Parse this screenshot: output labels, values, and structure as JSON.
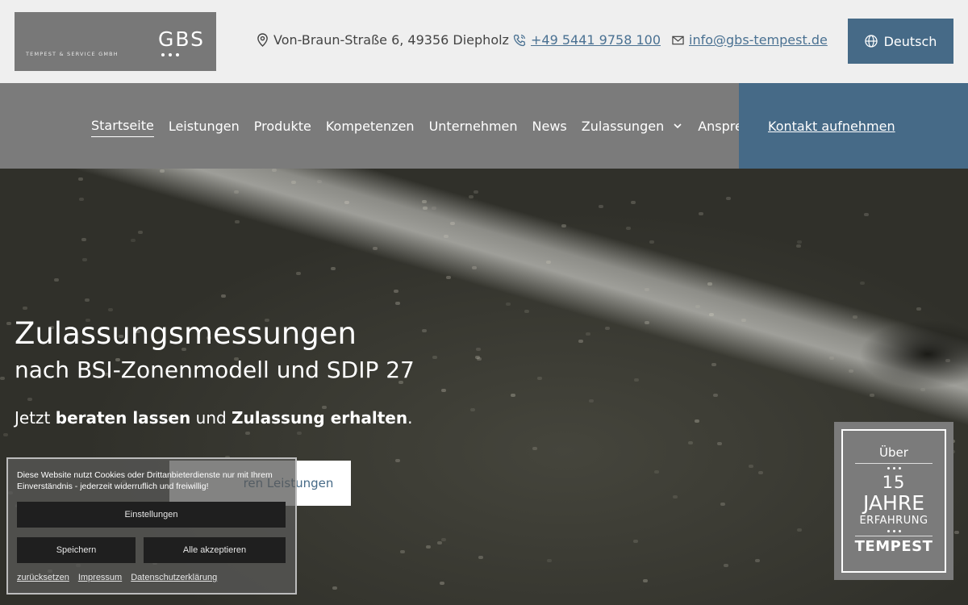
{
  "header": {
    "logo_text": "GBS",
    "logo_subtitle": "TEMPEST & SERVICE GMBH",
    "address": "Von-Braun-Straße 6, 49356 Diepholz",
    "phone": "+49 5441 9758 100",
    "email": "info@gbs-tempest.de",
    "language_label": "Deutsch"
  },
  "nav": {
    "items": [
      {
        "label": "Startseite",
        "active": true
      },
      {
        "label": "Leistungen"
      },
      {
        "label": "Produkte"
      },
      {
        "label": "Kompetenzen"
      },
      {
        "label": "Unternehmen"
      },
      {
        "label": "News"
      },
      {
        "label": "Zulassungen",
        "has_dropdown": true
      },
      {
        "label": "Ansprechpartner"
      }
    ],
    "cta_label": "Kontakt aufnehmen"
  },
  "hero": {
    "title": "Zulassungsmessungen",
    "subtitle": "nach BSI-Zonenmodell und SDIP 27",
    "lead_1": "Jetzt ",
    "lead_bold_1": "beraten lassen",
    "lead_2": " und ",
    "lead_bold_2": "Zulassung erhalten",
    "lead_3": ".",
    "button_secondary_partial": "ren Leistungen"
  },
  "badge": {
    "ueber": "Über",
    "years": "15",
    "jahre": "JAHRE",
    "erfahrung": "ERFAHRUNG",
    "tempest": "TEMPEST"
  },
  "cookie": {
    "text": "Diese Website nutzt Cookies oder Drittanbieterdienste nur mit Ihrem Einverständnis - jederzeit widerruflich und freiwillig!",
    "settings_label": "Einstellungen",
    "save_label": "Speichern",
    "accept_all_label": "Alle akzeptieren",
    "links": [
      "zurücksetzen",
      "Impressum",
      "Datenschutzerklärung"
    ]
  },
  "colors": {
    "accent_blue": "#466a87",
    "nav_gray": "#7b7b7b",
    "topbar_bg": "#efefef",
    "link_blue": "#4a7192"
  }
}
